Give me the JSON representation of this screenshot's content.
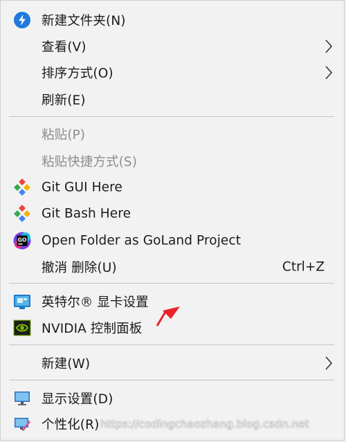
{
  "menu": {
    "items": [
      {
        "label": "新建文件夹(N)",
        "icon": "new-folder-icon",
        "disabled": false
      },
      {
        "label": "查看(V)",
        "submenu": true
      },
      {
        "label": "排序方式(O)",
        "submenu": true
      },
      {
        "label": "刷新(E)"
      },
      {
        "label": "粘贴(P)",
        "disabled": true
      },
      {
        "label": "粘贴快捷方式(S)",
        "disabled": true
      },
      {
        "label": "Git GUI Here",
        "icon": "git-icon"
      },
      {
        "label": "Git Bash Here",
        "icon": "git-icon"
      },
      {
        "label": "Open Folder as GoLand Project",
        "icon": "goland-icon"
      },
      {
        "label": "撤消 删除(U)",
        "shortcut": "Ctrl+Z"
      },
      {
        "label": "英特尔® 显卡设置",
        "icon": "intel-graphics-icon"
      },
      {
        "label": "NVIDIA 控制面板",
        "icon": "nvidia-icon"
      },
      {
        "label": "新建(W)",
        "submenu": true
      },
      {
        "label": "显示设置(D)",
        "icon": "display-settings-icon"
      },
      {
        "label": "个性化(R)",
        "icon": "personalize-icon"
      }
    ]
  },
  "watermark": "https://codingchaozhang.blog.csdn.net",
  "colors": {
    "menu_bg": "#f2f2f2",
    "disabled_text": "#8d8d8d",
    "pointer_arrow": "#e8222a",
    "accent_blue": "#1e7ae0"
  }
}
